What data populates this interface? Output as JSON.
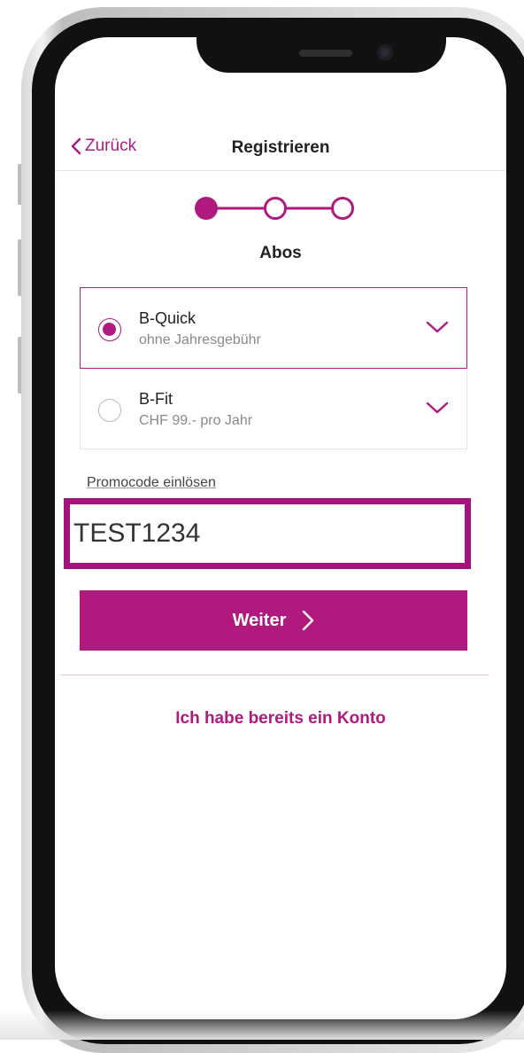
{
  "nav": {
    "back_label": "Zurück",
    "title": "Registrieren"
  },
  "stepper": {
    "current_step": 1,
    "total_steps": 3
  },
  "section": {
    "title": "Abos"
  },
  "plans": [
    {
      "name": "B-Quick",
      "subtitle": "ohne Jahresgebühr",
      "selected": true
    },
    {
      "name": "B-Fit",
      "subtitle": "CHF 99.- pro Jahr",
      "selected": false
    }
  ],
  "promo": {
    "label": "Promocode einlösen",
    "value": "TEST1234"
  },
  "actions": {
    "continue_label": "Weiter",
    "login_link": "Ich habe bereits ein Konto"
  },
  "colors": {
    "accent": "#b0197e",
    "highlight_border": "#a4127d"
  }
}
